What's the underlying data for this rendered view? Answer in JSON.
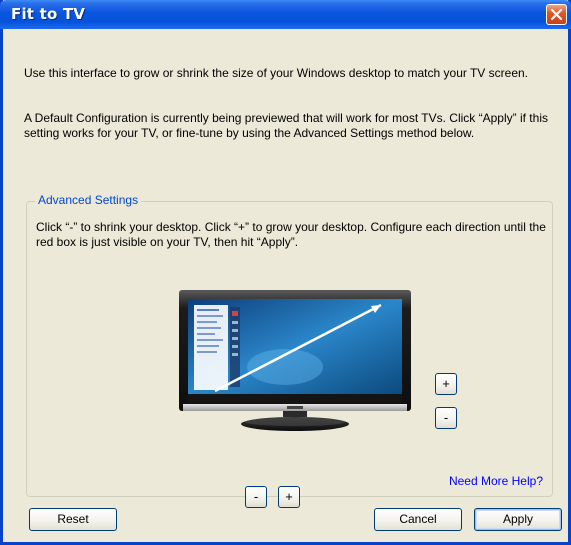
{
  "window": {
    "title": "Fit to TV",
    "close_icon": "close-icon"
  },
  "intro": {
    "line1": "Use this interface to grow or shrink the size of your Windows desktop to match your TV screen.",
    "line2": "A Default Configuration is currently being previewed that will work for most TVs. Click “Apply” if this setting works for your TV, or fine-tune by using the Advanced Settings method below."
  },
  "advanced": {
    "label": "Advanced Settings",
    "instructions": "Click “-” to shrink  your desktop. Click “+” to grow your desktop. Configure each direction until the red box is just visible on your TV, then hit “Apply”.",
    "vertical_plus": "+",
    "vertical_minus": "-",
    "horizontal_minus": "-",
    "horizontal_plus": "+",
    "help_link": "Need More Help?",
    "tv_icon": "tv-monitor-icon"
  },
  "footer": {
    "reset": "Reset",
    "cancel": "Cancel",
    "apply": "Apply"
  },
  "colors": {
    "title_blue": "#0a55e0",
    "dialog_bg": "#ece9d8",
    "link_blue": "#0000ff",
    "group_label_blue": "#0046d5"
  }
}
